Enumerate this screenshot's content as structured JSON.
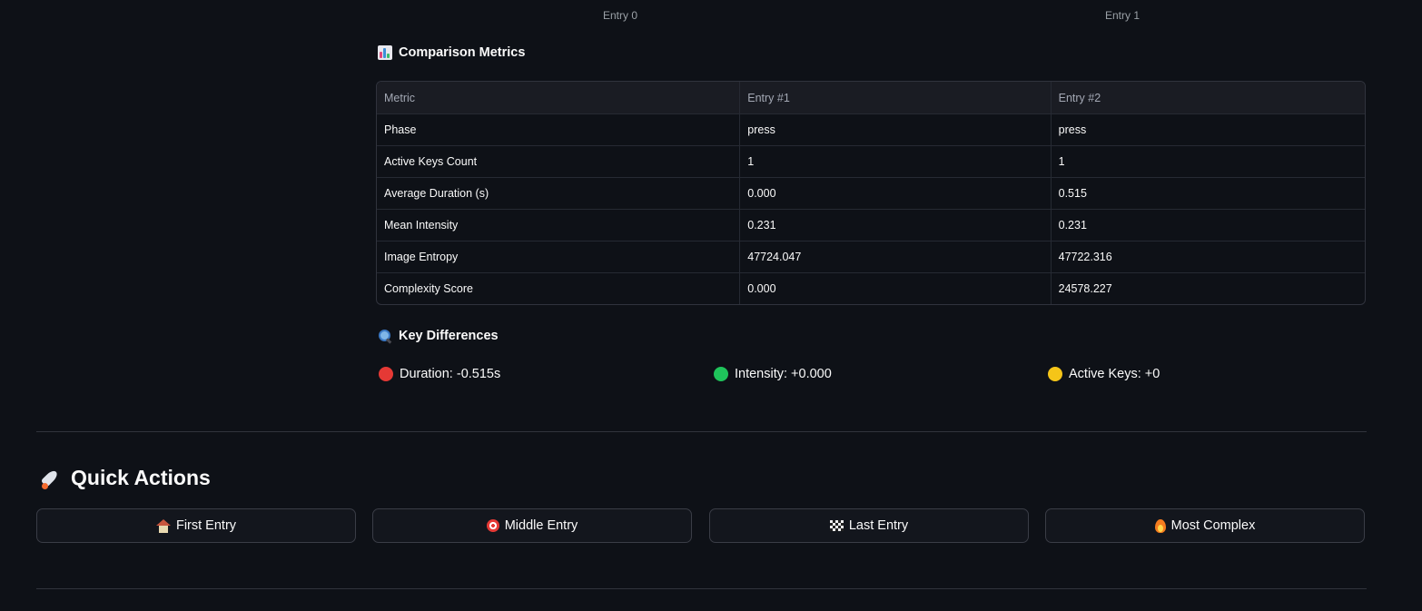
{
  "captions": [
    "Entry 0",
    "Entry 1"
  ],
  "comparison": {
    "title": "Comparison Metrics",
    "icon": "bar-chart-icon",
    "columns": [
      "Metric",
      "Entry #1",
      "Entry #2"
    ],
    "rows": [
      [
        "Phase",
        "press",
        "press"
      ],
      [
        "Active Keys Count",
        "1",
        "1"
      ],
      [
        "Average Duration (s)",
        "0.000",
        "0.515"
      ],
      [
        "Mean Intensity",
        "0.231",
        "0.231"
      ],
      [
        "Image Entropy",
        "47724.047",
        "47722.316"
      ],
      [
        "Complexity Score",
        "0.000",
        "24578.227"
      ]
    ]
  },
  "differences": {
    "title": "Key Differences",
    "icon": "magnifier-icon",
    "items": [
      {
        "text": "Duration: -0.515s",
        "color": "#e53935",
        "icon": "red-circle-icon"
      },
      {
        "text": "Intensity: +0.000",
        "color": "#1fc45b",
        "icon": "green-circle-icon"
      },
      {
        "text": "Active Keys: +0",
        "color": "#f5c518",
        "icon": "yellow-circle-icon"
      }
    ]
  },
  "quick_actions": {
    "title": "Quick Actions",
    "icon": "rocket-icon",
    "buttons": [
      {
        "label": "First Entry",
        "icon": "house-icon"
      },
      {
        "label": "Middle Entry",
        "icon": "target-icon"
      },
      {
        "label": "Last Entry",
        "icon": "checkered-flag-icon"
      },
      {
        "label": "Most Complex",
        "icon": "fire-icon"
      }
    ]
  },
  "colors": {
    "background": "#0e1117",
    "border": "#30333d",
    "text": "#fafafa",
    "muted": "#a3a8b4"
  }
}
